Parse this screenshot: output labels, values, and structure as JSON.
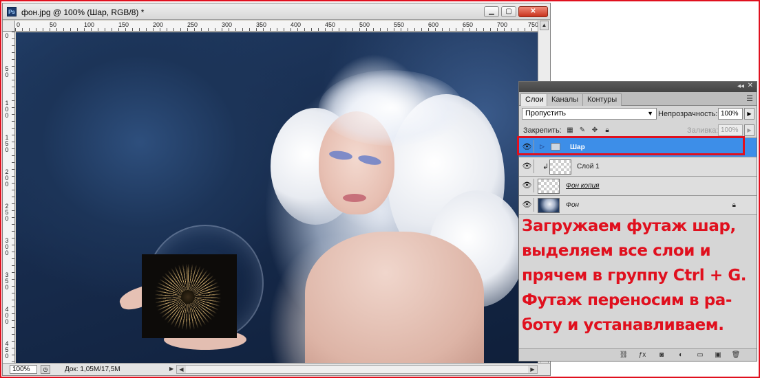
{
  "document": {
    "title": "фон.jpg @ 100% (Шар, RGB/8) *",
    "app_icon": "Ps",
    "ruler_top_labels": [
      "0",
      "50",
      "100",
      "150",
      "200",
      "250",
      "300",
      "350",
      "400",
      "450",
      "500",
      "550",
      "600",
      "650",
      "700",
      "750"
    ],
    "ruler_left_labels": [
      "0",
      "5\n0",
      "1\n0\n0",
      "1\n5\n0",
      "2\n0\n0",
      "2\n5\n0",
      "3\n0\n0",
      "3\n5\n0",
      "4\n0\n0",
      "4\n5\n0"
    ],
    "status": {
      "zoom": "100%",
      "doc_info": "Док: 1,05M/17,5M"
    }
  },
  "layers_panel": {
    "tabs": [
      "Слои",
      "Каналы",
      "Контуры"
    ],
    "blend_mode": "Пропустить",
    "opacity_label": "Непрозрачность:",
    "opacity_value": "100%",
    "lock_label": "Закрепить:",
    "fill_label": "Заливка:",
    "fill_value": "100%",
    "layers": [
      {
        "name": "Шар",
        "type": "group",
        "selected": true
      },
      {
        "name": "Слой 1",
        "type": "clipped"
      },
      {
        "name": "Фон копия",
        "type": "layer"
      },
      {
        "name": "Фон",
        "type": "background",
        "locked": true
      }
    ]
  },
  "caption": {
    "lines": [
      "Загружаем футаж шар,",
      "выделяем все слои и",
      "прячем в группу Ctrl + G.",
      "Футаж переносим в ра-",
      "боту и устанавливаем."
    ],
    "color": "#e0101e"
  },
  "colors": {
    "highlight_border": "#e0101e",
    "selected_layer": "#3d8ee8"
  }
}
